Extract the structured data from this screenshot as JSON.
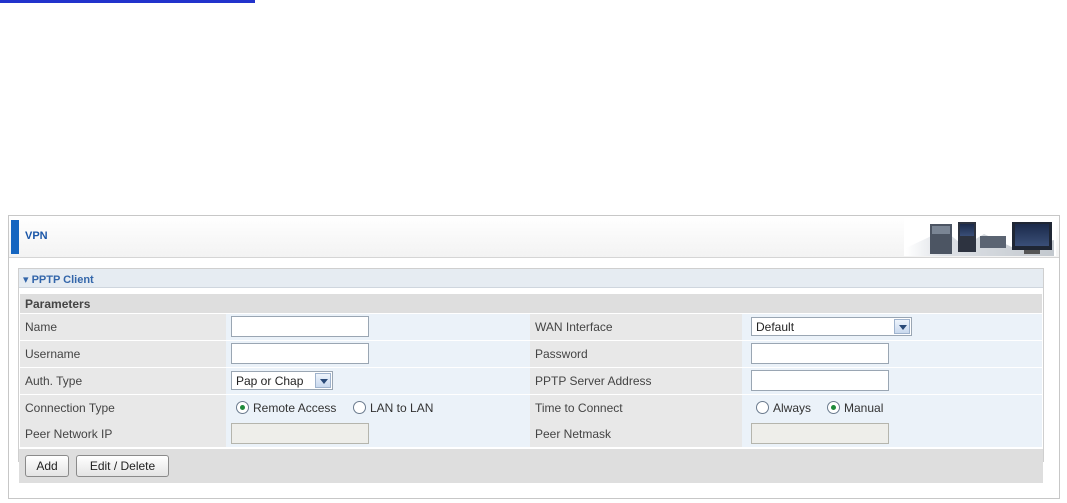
{
  "header": {
    "title": "VPN"
  },
  "section": {
    "title": "PPTP Client"
  },
  "params": {
    "title": "Parameters"
  },
  "fields": {
    "name": {
      "label": "Name",
      "value": ""
    },
    "wan_interface": {
      "label": "WAN Interface",
      "value": "Default"
    },
    "username": {
      "label": "Username",
      "value": ""
    },
    "password": {
      "label": "Password",
      "value": ""
    },
    "auth_type": {
      "label": "Auth. Type",
      "value": "Pap or Chap"
    },
    "server_address": {
      "label": "PPTP Server Address",
      "value": ""
    },
    "connection_type": {
      "label": "Connection Type",
      "options": [
        "Remote Access",
        "LAN to LAN"
      ],
      "selected": "Remote Access"
    },
    "time_to_connect": {
      "label": "Time to Connect",
      "options": [
        "Always",
        "Manual"
      ],
      "selected": "Manual"
    },
    "peer_network_ip": {
      "label": "Peer Network IP",
      "value": ""
    },
    "peer_netmask": {
      "label": "Peer Netmask",
      "value": ""
    }
  },
  "buttons": {
    "add": "Add",
    "edit_delete": "Edit / Delete"
  },
  "colors": {
    "accent": "#1565c0",
    "section_title": "#3366aa",
    "value_cell": "#ebf2f9",
    "label_cell": "#e8e8e8"
  }
}
